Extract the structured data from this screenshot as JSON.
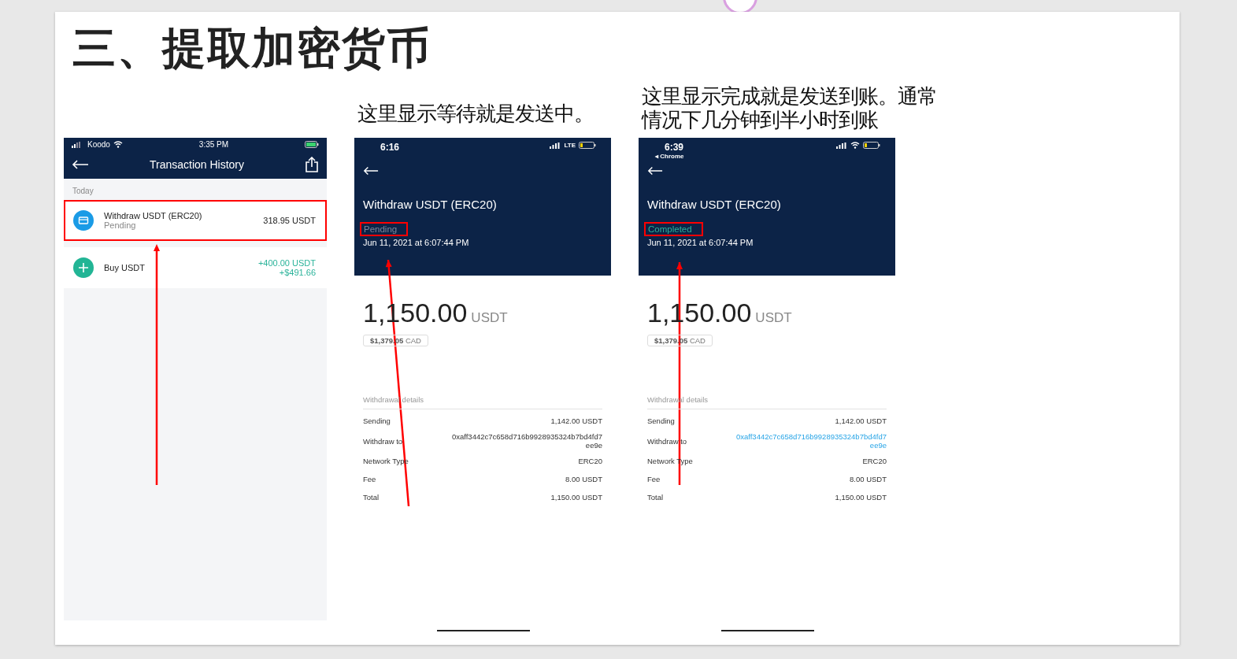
{
  "title": "三、提取加密货币",
  "history_screen": {
    "status_bar": {
      "carrier": "Koodo",
      "time": "3:35 PM"
    },
    "nav_title": "Transaction History",
    "section": "Today",
    "annotation_arrow": true,
    "rows": [
      {
        "kind": "withdraw",
        "title": "Withdraw USDT (ERC20)",
        "subtitle": "Pending",
        "amounts": [
          "318.95 USDT"
        ],
        "highlighted": true
      },
      {
        "kind": "buy",
        "title": "Buy USDT",
        "amounts": [
          "+400.00 USDT",
          "+$491.66"
        ],
        "highlighted": false
      }
    ]
  },
  "detail_screens": [
    {
      "caption": "这里显示等待就是发送中。",
      "status_bar": {
        "time": "6:16",
        "network": "LTE"
      },
      "title": "Withdraw USDT (ERC20)",
      "status": {
        "text": "Pending",
        "color": "#7d8799",
        "highlighted": true
      },
      "date": "Jun 11, 2021 at 6:07:44 PM",
      "amount": "1,150.00",
      "currency": "USDT",
      "fiat": "$1,379.05",
      "fiat_currency": "CAD",
      "details_heading": "Withdrawal details",
      "annotation_arrow": true,
      "details": [
        {
          "label": "Sending",
          "values": [
            "1,142.00 USDT"
          ],
          "link": false
        },
        {
          "label": "Withdraw to",
          "values": [
            "0xaff3442c7c658d716b9928935324b7bd4fd7",
            "ee9e"
          ],
          "link": false
        },
        {
          "label": "Network Type",
          "values": [
            "ERC20"
          ],
          "link": false
        },
        {
          "label": "Fee",
          "values": [
            "8.00 USDT"
          ],
          "link": false
        },
        {
          "label": "Total",
          "values": [
            "1,150.00 USDT"
          ],
          "link": false
        }
      ]
    },
    {
      "caption": "这里显示完成就是发送到账。通常情况下几分钟到半小时到账",
      "status_bar": {
        "time": "6:39",
        "back_app": "◂ Chrome"
      },
      "title": "Withdraw USDT (ERC20)",
      "status": {
        "text": "Completed",
        "color": "#2bb39a",
        "highlighted": true
      },
      "date": "Jun 11, 2021 at 6:07:44 PM",
      "amount": "1,150.00",
      "currency": "USDT",
      "fiat": "$1,379.05",
      "fiat_currency": "CAD",
      "details_heading": "Withdrawal details",
      "annotation_arrow": true,
      "details": [
        {
          "label": "Sending",
          "values": [
            "1,142.00 USDT"
          ],
          "link": false
        },
        {
          "label": "Withdraw to",
          "values": [
            "0xaff3442c7c658d716b9928935324b7bd4fd7",
            "ee9e"
          ],
          "link": true
        },
        {
          "label": "Network Type",
          "values": [
            "ERC20"
          ],
          "link": false
        },
        {
          "label": "Fee",
          "values": [
            "8.00 USDT"
          ],
          "link": false
        },
        {
          "label": "Total",
          "values": [
            "1,150.00 USDT"
          ],
          "link": false
        }
      ]
    }
  ]
}
